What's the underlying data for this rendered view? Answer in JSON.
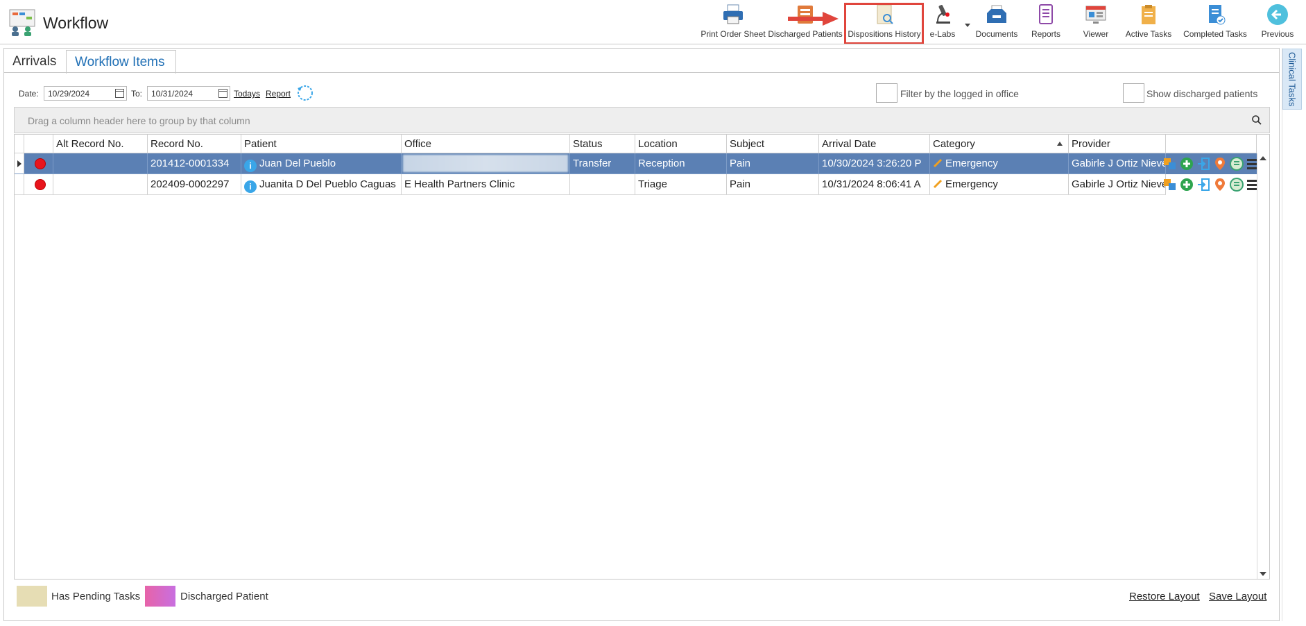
{
  "app": {
    "title": "Workflow"
  },
  "toolbar": {
    "buttons": [
      {
        "label": "Print Order Sheet",
        "icon": "printer-icon"
      },
      {
        "label": "Discharged Patients",
        "icon": "discharged-patients-icon"
      },
      {
        "label": "Dispositions History",
        "icon": "dispositions-history-icon",
        "highlighted": true
      },
      {
        "label": "e-Labs",
        "icon": "microscope-icon"
      },
      {
        "label": "Documents",
        "icon": "documents-tray-icon"
      },
      {
        "label": "Reports",
        "icon": "reports-icon"
      },
      {
        "label": "Viewer",
        "icon": "viewer-icon"
      },
      {
        "label": "Active Tasks",
        "icon": "active-tasks-icon"
      },
      {
        "label": "Completed Tasks",
        "icon": "completed-tasks-icon"
      },
      {
        "label": "Previous",
        "icon": "back-arrow-icon"
      }
    ]
  },
  "tabs": {
    "arrivals": "Arrivals",
    "workflow_items": "Workflow Items"
  },
  "side_panel": {
    "clinical_tasks": "Clinical Tasks"
  },
  "filters": {
    "date_label": "Date:",
    "date_from": "10/29/2024",
    "to_label": "To:",
    "date_to": "10/31/2024",
    "todays": "Todays",
    "report": "Report",
    "filter_office_label": "Filter by the logged in office",
    "show_discharged_label": "Show discharged patients"
  },
  "grid": {
    "group_hint": "Drag a column header here to group by that column",
    "columns": [
      "Alt Record No.",
      "Record No.",
      "Patient",
      "Office",
      "Status",
      "Location",
      "Subject",
      "Arrival Date",
      "Category",
      "Provider"
    ],
    "rows": [
      {
        "alt_record": "",
        "record": "201412-0001334",
        "patient": "Juan Del Pueblo",
        "office": "",
        "status": "Transfer",
        "location": "Reception",
        "subject": "Pain",
        "arrival": "10/30/2024 3:26:20 P",
        "category": "Emergency",
        "provider": "Gabirle J Ortiz Nieve",
        "selected": true
      },
      {
        "alt_record": "",
        "record": "202409-0002297",
        "patient": "Juanita D Del Pueblo Caguas",
        "office": "E Health Partners Clinic",
        "status": "",
        "location": "Triage",
        "subject": "Pain",
        "arrival": "10/31/2024 8:06:41 A",
        "category": "Emergency",
        "provider": "Gabirle J Ortiz Nieve",
        "selected": false
      }
    ],
    "sorted_column": "Category"
  },
  "legend": {
    "pending": "Has Pending Tasks",
    "discharged": "Discharged Patient",
    "pending_color": "#e6ddb4",
    "discharged_color": "#e763a8"
  },
  "footer": {
    "restore": "Restore Layout",
    "save": "Save Layout"
  },
  "colors": {
    "selected_row": "#5b80b4",
    "accent": "#1f6fb5",
    "status_dot": "#e8141c",
    "highlight_box": "#e0453c"
  }
}
